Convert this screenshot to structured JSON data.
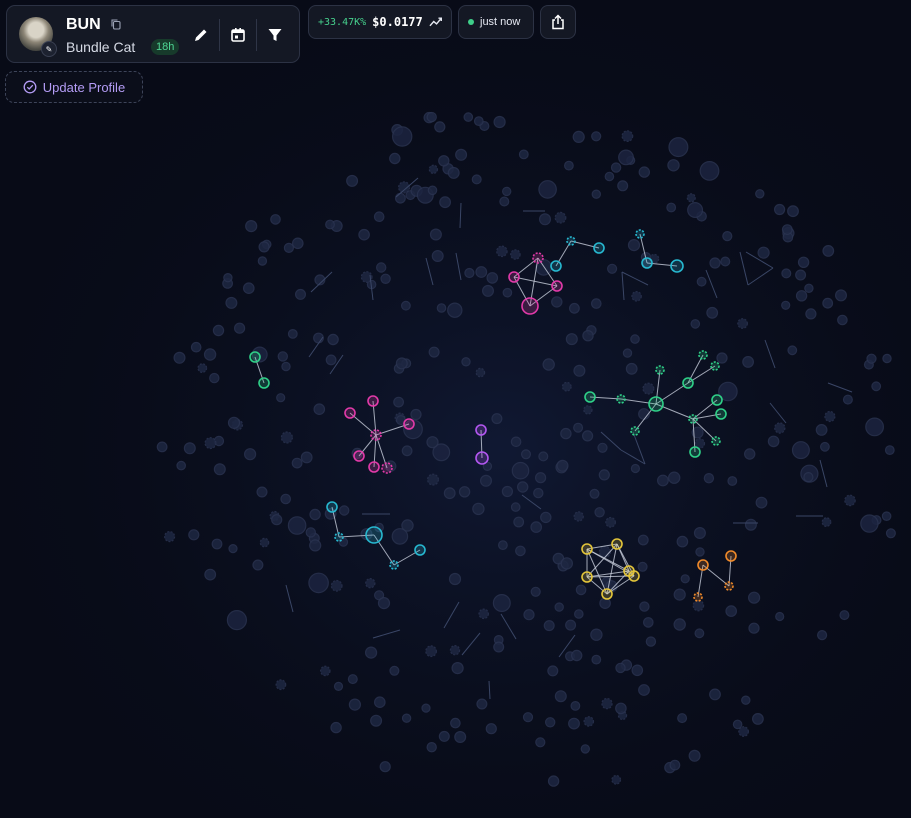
{
  "token": {
    "ticker": "BUN",
    "name": "Bundle Cat",
    "age": "18h"
  },
  "market": {
    "change": "+33.47K%",
    "price": "$0.0177"
  },
  "status": {
    "updated": "just now",
    "indicator_color": "#3fcf8a"
  },
  "actions": {
    "update_profile_label": "Update Profile"
  },
  "icons": {
    "copy": "copy-icon",
    "edit": "pencil-icon",
    "calendar": "calendar-icon",
    "filter": "filter-icon",
    "trend": "trend-line-icon",
    "share": "share-icon",
    "verified": "check-circle-icon"
  },
  "colors": {
    "background": "#080b17",
    "idle_node": "#2a3350",
    "cluster_magenta": "#e23aa9",
    "cluster_cyan": "#27b8d0",
    "cluster_green": "#2fd088",
    "cluster_purple": "#b357f0",
    "cluster_yellow": "#e3c53a",
    "cluster_orange": "#f08a2a",
    "accent": "#b49cf5"
  }
}
